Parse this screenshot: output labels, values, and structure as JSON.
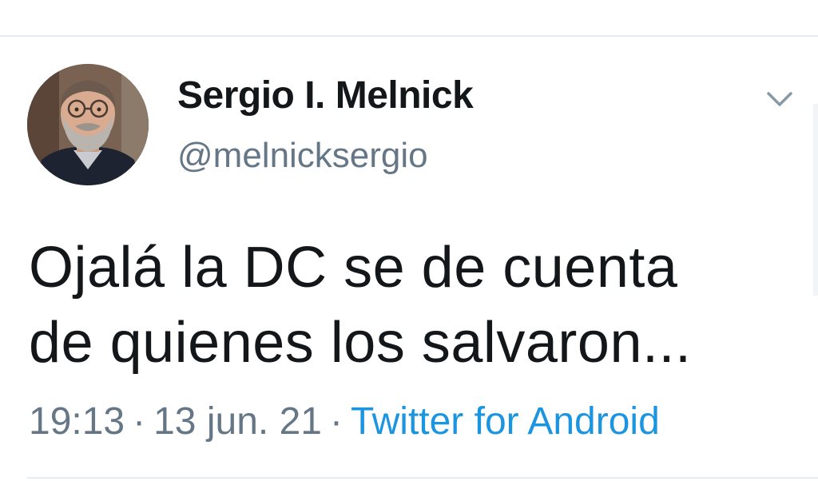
{
  "tweet": {
    "author": {
      "display_name": "Sergio I. Melnick",
      "handle": "@melnicksergio"
    },
    "text_lines": [
      "Ojalá la DC se de cuenta",
      "de quienes los salvaron..."
    ],
    "time": "19:13",
    "date": "13 jun. 21",
    "separator": "·",
    "source": "Twitter for Android",
    "menu_icon": "chevron-down-icon"
  },
  "colors": {
    "text": "#14171a",
    "secondary": "#657786",
    "link": "#1b95e0",
    "divider": "#e6ecf0"
  }
}
